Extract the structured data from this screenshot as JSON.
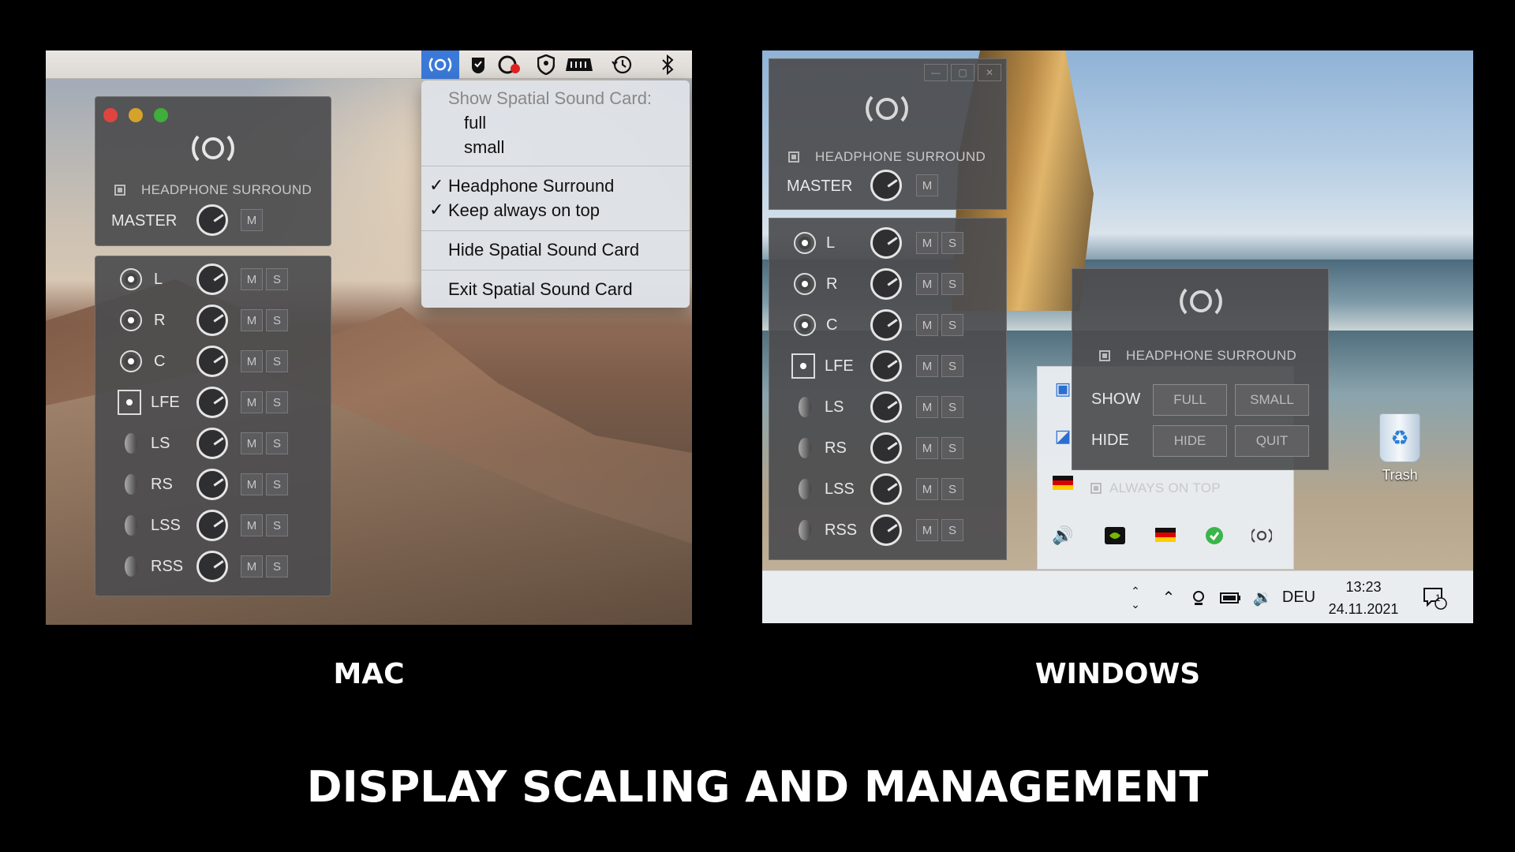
{
  "labels": {
    "mac": "MAC",
    "windows": "WINDOWS",
    "headline": "DISPLAY SCALING AND MANAGEMENT"
  },
  "mac": {
    "menubar_icons": [
      "spatial-sound-icon",
      "check-shield-icon",
      "cloud-badge-icon",
      "shield-icon",
      "hardware-icon",
      "clock-history-icon",
      "bluetooth-icon"
    ],
    "menu": {
      "header": "Show Spatial Sound Card:",
      "full": "full",
      "small": "small",
      "headphone_surround": "Headphone Surround",
      "keep_on_top": "Keep always on top",
      "hide": "Hide Spatial Sound Card",
      "exit": "Exit Spatial Sound Card",
      "check": "✓"
    },
    "card": {
      "headphone_surround": "HEADPHONE SURROUND",
      "master": "MASTER",
      "mute": "M"
    },
    "channels": [
      {
        "name": "L"
      },
      {
        "name": "R"
      },
      {
        "name": "C"
      },
      {
        "name": "LFE"
      },
      {
        "name": "LS"
      },
      {
        "name": "RS"
      },
      {
        "name": "LSS"
      },
      {
        "name": "RSS"
      }
    ],
    "mute": "M",
    "solo": "S"
  },
  "windows": {
    "card": {
      "headphone_surround": "HEADPHONE SURROUND",
      "master": "MASTER",
      "mute": "M"
    },
    "channels": [
      {
        "name": "L"
      },
      {
        "name": "R"
      },
      {
        "name": "C"
      },
      {
        "name": "LFE"
      },
      {
        "name": "LS"
      },
      {
        "name": "RS"
      },
      {
        "name": "LSS"
      },
      {
        "name": "RSS"
      }
    ],
    "mute": "M",
    "solo": "S",
    "small_card": {
      "headphone_surround": "HEADPHONE SURROUND",
      "show": "SHOW",
      "full": "FULL",
      "small": "SMALL",
      "hide_label": "HIDE",
      "hide": "HIDE",
      "quit": "QUIT",
      "always_on_top": "ALWAYS ON TOP"
    },
    "taskbar": {
      "language": "DEU",
      "time": "13:23",
      "date": "24.11.2021",
      "notifications": "1"
    },
    "desktop": {
      "trash": "Trash"
    }
  }
}
